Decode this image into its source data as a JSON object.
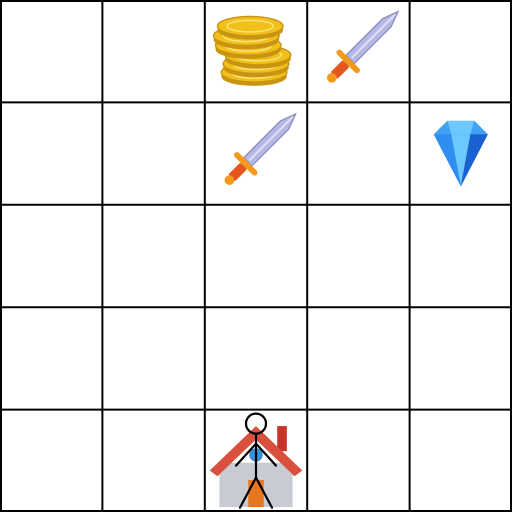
{
  "grid": {
    "rows": 5,
    "cols": 5,
    "line_color": "#000000",
    "background": "#ffffff"
  },
  "items": [
    {
      "kind": "coins",
      "row": 0,
      "col": 2
    },
    {
      "kind": "sword",
      "row": 0,
      "col": 3
    },
    {
      "kind": "sword",
      "row": 1,
      "col": 2
    },
    {
      "kind": "gem",
      "row": 1,
      "col": 4
    },
    {
      "kind": "house",
      "row": 4,
      "col": 2
    }
  ],
  "player": {
    "row": 4,
    "col": 2,
    "icon": "stick-figure-icon"
  },
  "colors": {
    "coin_gold": "#f2c01b",
    "coin_shadow": "#c99412",
    "blade": "#b4b8e4",
    "blade_edge": "#8f93c4",
    "guard": "#f39a1c",
    "grip": "#e5561c",
    "gem_light": "#6cc8ff",
    "gem_dark": "#1c74e8",
    "roof": "#d9503f",
    "chimney": "#c8332c",
    "wall": "#c8ccd2",
    "window": "#3a8fd9",
    "door": "#e8761e"
  }
}
